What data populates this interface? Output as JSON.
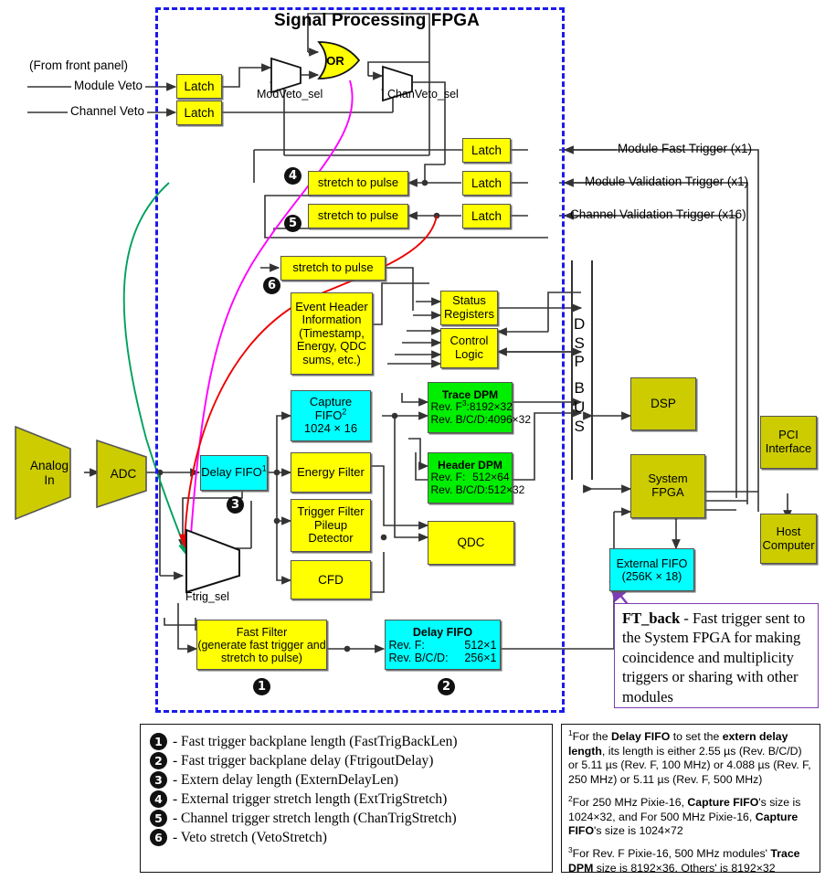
{
  "diagram": {
    "title": "Signal Processing FPGA",
    "colors": {
      "fpga_border": "#1a1aee",
      "yellow_block": "#ffff00",
      "cyan_block": "#00ffff",
      "green_block": "#00ee00",
      "olive_block": "#cccc00",
      "veto_wire_magenta": "#ff00ff",
      "veto_wire_green": "#00a060",
      "veto_wire_red": "#ee0000",
      "ftback_border": "#7d3cb5"
    }
  },
  "inputs": {
    "front_panel_note": "(From front panel)",
    "module_veto": "Module Veto",
    "channel_veto": "Channel Veto",
    "module_fast_trigger": "Module Fast Trigger (x1)",
    "module_validation_trigger": "Module Validation Trigger (x1)",
    "channel_validation_trigger": "Channel Validation Trigger (x16)"
  },
  "mux_labels": {
    "modveto_sel": "ModVeto_sel",
    "chanveto_sel": "ChanVeto_sel",
    "ftrig_sel": "Ftrig_sel"
  },
  "gates": {
    "or_gate": "OR"
  },
  "latches": [
    {
      "label": "Latch",
      "name": "latch-module-veto"
    },
    {
      "label": "Latch",
      "name": "latch-channel-veto"
    },
    {
      "label": "Latch",
      "name": "latch-module-fast-trigger"
    },
    {
      "label": "Latch",
      "name": "latch-module-validation-trigger"
    },
    {
      "label": "Latch",
      "name": "latch-channel-validation-trigger"
    }
  ],
  "stretch_blocks": [
    {
      "label": "stretch to pulse",
      "bullet": "4"
    },
    {
      "label": "stretch to pulse",
      "bullet": "5"
    },
    {
      "label": "stretch to pulse",
      "bullet": "6"
    }
  ],
  "blocks": {
    "analog_in": {
      "line1": "Analog",
      "line2": "In"
    },
    "adc": {
      "line1": "ADC"
    },
    "delay_fifo_in": {
      "line1": "Delay FIFO",
      "sup": "1"
    },
    "event_header": {
      "line1": "Event Header",
      "line2": "Information",
      "line3": "(Timestamp,",
      "line4": "Energy, QDC",
      "line5": "sums, etc.)"
    },
    "capture_fifo": {
      "line1": "Capture",
      "line2": "FIFO",
      "sup": "2",
      "line3": "1024 × 16"
    },
    "energy_filter": {
      "line1": "Energy Filter"
    },
    "trigger_filter": {
      "line1": "Trigger Filter",
      "line2": "Pileup",
      "line3": "Detector"
    },
    "cfd": {
      "line1": "CFD"
    },
    "qdc": {
      "line1": "QDC"
    },
    "status_registers": {
      "line1": "Status",
      "line2": "Registers"
    },
    "control_logic": {
      "line1": "Control",
      "line2": "Logic"
    },
    "trace_dpm": {
      "title": "Trace DPM",
      "sup": "3",
      "row1_label": "Rev. F",
      "row1_value": "8192×32",
      "row2_label": "Rev. B/C/D:",
      "row2_value": "4096×32"
    },
    "header_dpm": {
      "title": "Header DPM",
      "row1_label": "Rev. F:",
      "row1_value": "512×64",
      "row2_label": "Rev. B/C/D:",
      "row2_value": "512×32"
    },
    "fast_filter": {
      "line1": "Fast Filter",
      "line2": "(generate fast trigger and",
      "line3": "stretch to pulse)",
      "bullet": "1"
    },
    "delay_fifo_out": {
      "title": "Delay FIFO",
      "row1_label": "Rev. F:",
      "row1_value": "512×1",
      "row2_label": "Rev. B/C/D:",
      "row2_value": "256×1",
      "bullet": "2"
    },
    "dsp": {
      "line1": "DSP"
    },
    "system_fpga": {
      "line1": "System",
      "line2": "FPGA"
    },
    "external_fifo": {
      "line1": "External FIFO",
      "line2": "(256K × 18)"
    },
    "pci_interface": {
      "line1": "PCI",
      "line2": "Interface"
    },
    "host_computer": {
      "line1": "Host",
      "line2": "Computer"
    }
  },
  "bus": {
    "letters": "DSP BUS",
    "chars": [
      "D",
      "S",
      "P",
      "",
      "B",
      "U",
      "S"
    ]
  },
  "ftback_note": {
    "term": "FT_back",
    "text": " - Fast trigger sent to the System FPGA for making coincidence and multiplicity triggers or sharing with other modules"
  },
  "legend": {
    "items": [
      {
        "num": "1",
        "text": "- Fast trigger backplane length (FastTrigBackLen)"
      },
      {
        "num": "2",
        "text": "- Fast trigger backplane delay (FtrigoutDelay)"
      },
      {
        "num": "3",
        "text": "- Extern delay length (ExternDelayLen)"
      },
      {
        "num": "4",
        "text": "- External trigger stretch length (ExtTrigStretch)"
      },
      {
        "num": "5",
        "text": "- Channel trigger stretch length (ChanTrigStretch)"
      },
      {
        "num": "6",
        "text": "- Veto stretch (VetoStretch)"
      }
    ]
  },
  "footnotes": [
    {
      "marker": "1",
      "html_parts": [
        "For the ",
        "Delay FIFO",
        " to set the ",
        "extern delay length",
        ", its length is either 2.55 µs (Rev. B/C/D) or 5.11 µs (Rev. F, 100 MHz) or 4.088 µs (Rev. F, 250 MHz) or 5.11 µs (Rev. F, 500 MHz)"
      ]
    },
    {
      "marker": "2",
      "html_parts": [
        "For 250 MHz Pixie-16, ",
        "Capture FIFO",
        "'s size is 1024×32, and For 500 MHz Pixie-16, ",
        "Capture FIFO",
        "'s size is 1024×72"
      ]
    },
    {
      "marker": "3",
      "html_parts": [
        "For Rev. F Pixie-16, 500 MHz modules' ",
        "Trace DPM",
        " size is 8192×36. Others' is 8192×32"
      ]
    }
  ]
}
